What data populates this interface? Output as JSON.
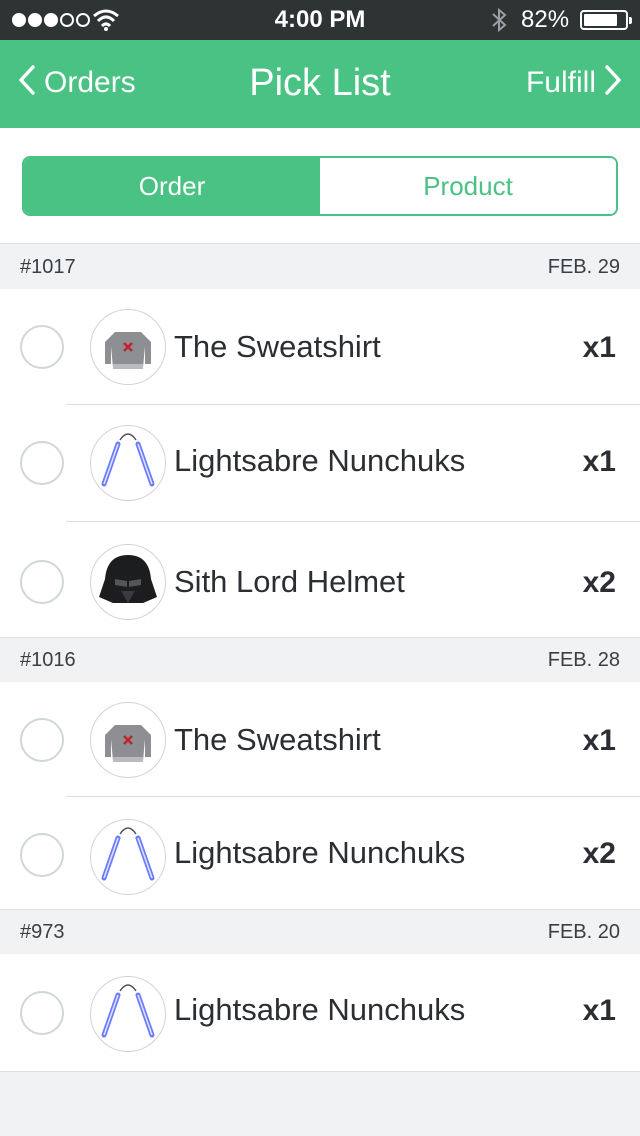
{
  "status_bar": {
    "time": "4:00 PM",
    "battery": "82%",
    "battery_level": 0.82,
    "signal_bars_filled": 3,
    "signal_bars_total": 5
  },
  "nav": {
    "back_label": "Orders",
    "title": "Pick List",
    "forward_label": "Fulfill",
    "bg_color": "#49c283"
  },
  "segment": {
    "options": [
      "Order",
      "Product"
    ],
    "selected": "Order"
  },
  "orders": [
    {
      "number": "#1017",
      "date": "FEB. 29",
      "items": [
        {
          "name": "The Sweatshirt",
          "qty": "x1",
          "icon": "sweatshirt-icon"
        },
        {
          "name": "Lightsabre Nunchuks",
          "qty": "x1",
          "icon": "nunchuks-icon"
        },
        {
          "name": "Sith Lord Helmet",
          "qty": "x2",
          "icon": "helmet-icon"
        }
      ]
    },
    {
      "number": "#1016",
      "date": "FEB. 28",
      "items": [
        {
          "name": "The Sweatshirt",
          "qty": "x1",
          "icon": "sweatshirt-icon"
        },
        {
          "name": "Lightsabre Nunchuks",
          "qty": "x2",
          "icon": "nunchuks-icon"
        }
      ]
    },
    {
      "number": "#973",
      "date": "FEB. 20",
      "items": [
        {
          "name": "Lightsabre Nunchuks",
          "qty": "x1",
          "icon": "nunchuks-icon"
        }
      ]
    }
  ]
}
